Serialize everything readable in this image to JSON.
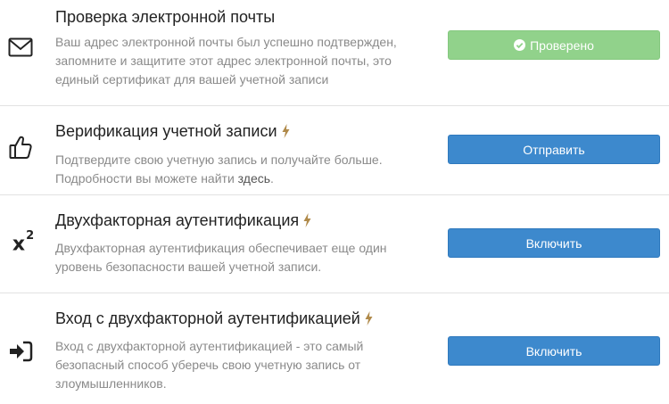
{
  "items": [
    {
      "icon": "envelope-icon",
      "title": "Проверка электронной почты",
      "description": "Ваш адрес электронной почты был успешно подтвержден, запомните и защитите этот адрес электронной почты, это единый сертификат для вашей учетной записи",
      "button": {
        "label": "Проверено",
        "state": "verified",
        "color": "#91d28b"
      }
    },
    {
      "icon": "thumbs-up-icon",
      "title": "Верификация учетной записи",
      "description_before": "Подтвердите свою учетную запись и получайте больше. Подробности вы можете найти ",
      "link": "здесь",
      "description_after": ".",
      "button": {
        "label": "Отправить",
        "color": "#3d89cd"
      }
    },
    {
      "icon": "x-squared-icon",
      "icon_text": "x",
      "icon_sup": "2",
      "title": "Двухфакторная аутентификация",
      "description": "Двухфакторная аутентификация обеспечивает еще один уровень безопасности вашей учетной записи.",
      "button": {
        "label": "Включить",
        "color": "#3d89cd"
      }
    },
    {
      "icon": "sign-in-icon",
      "title": "Вход с двухфакторной аутентификацией",
      "description": "Вход с двухфакторной аутентификацией - это самый безопасный способ уберечь свою учетную запись от злоумышленников.",
      "button": {
        "label": "Включить",
        "color": "#3d89cd"
      }
    }
  ],
  "colors": {
    "bolt": "#b08a4a",
    "divider": "#e2e2e2"
  }
}
